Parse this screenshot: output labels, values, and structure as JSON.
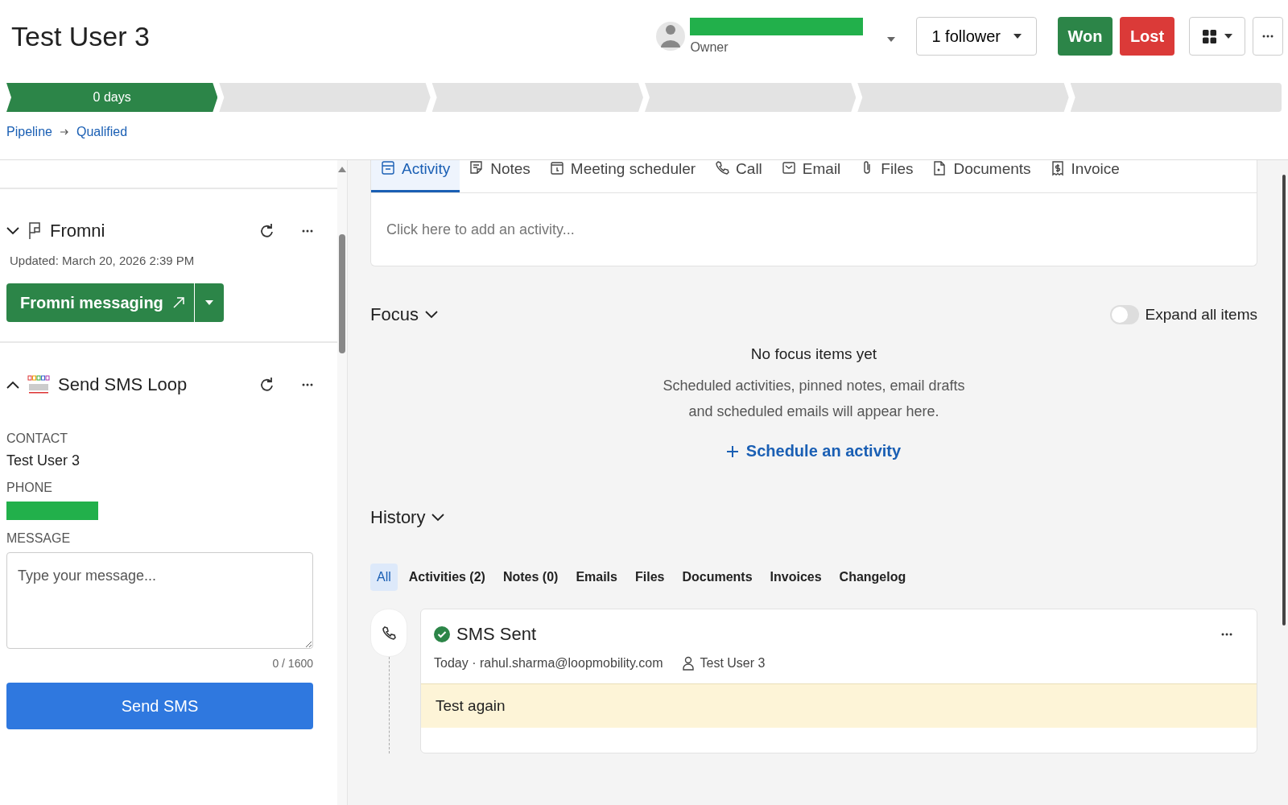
{
  "deal": {
    "title": "Test User 3",
    "owner_label": "Owner",
    "followers": "1 follower",
    "won": "Won",
    "lost": "Lost"
  },
  "stages": [
    {
      "label": "0 days",
      "selected": true
    },
    {
      "selected": false
    },
    {
      "selected": false
    },
    {
      "selected": false
    },
    {
      "selected": false
    },
    {
      "selected": false
    }
  ],
  "breadcrumb": [
    "Pipeline",
    "Qualified"
  ],
  "sidebar": {
    "sections": [
      {
        "kind": "fromni",
        "title": "Fromni",
        "expanded": false,
        "updated": "Updated: March 20, 2026 2:39 PM",
        "button": "Fromni messaging"
      },
      {
        "kind": "sms",
        "title": "Send SMS Loop",
        "expanded": true,
        "fields": [
          {
            "label": "CONTACT",
            "kind": "text",
            "value": "Test User 3"
          },
          {
            "label": "PHONE",
            "kind": "redacted"
          }
        ],
        "message_label": "MESSAGE",
        "placeholder": "Type your message...",
        "counter": "0 / 1600",
        "button": "Send SMS"
      }
    ]
  },
  "activity_tabs": [
    {
      "label": "Activity",
      "kind": "activity",
      "selected": true
    },
    {
      "label": "Notes",
      "kind": "notes",
      "selected": false
    },
    {
      "label": "Meeting scheduler",
      "kind": "meeting",
      "selected": false
    },
    {
      "label": "Call",
      "kind": "call",
      "selected": false
    },
    {
      "label": "Email",
      "kind": "email",
      "selected": false
    },
    {
      "label": "Files",
      "kind": "files",
      "selected": false
    },
    {
      "label": "Documents",
      "kind": "documents",
      "selected": false
    },
    {
      "label": "Invoice",
      "kind": "invoice",
      "selected": false
    }
  ],
  "composer": {
    "placeholder": "Click here to add an activity..."
  },
  "focus": {
    "title": "Focus",
    "toggle_label": "Expand all items",
    "toggle_on": false,
    "empty_title": "No focus items yet",
    "empty_text": "Scheduled activities, pinned notes, email drafts and scheduled emails will appear here.",
    "link": "Schedule an activity"
  },
  "history": {
    "title": "History",
    "filters": [
      {
        "label": "All",
        "selected": true
      },
      {
        "label": "Activities (2)",
        "selected": false
      },
      {
        "label": "Notes (0)",
        "selected": false
      },
      {
        "label": "Emails",
        "selected": false
      },
      {
        "label": "Files",
        "selected": false
      },
      {
        "label": "Documents",
        "selected": false
      },
      {
        "label": "Invoices",
        "selected": false
      },
      {
        "label": "Changelog",
        "selected": false
      }
    ],
    "items": [
      {
        "title": "SMS Sent",
        "meta": "Today · rahul.sharma@loopmobility.com",
        "contact": "Test User 3",
        "body": "Test again"
      }
    ]
  }
}
